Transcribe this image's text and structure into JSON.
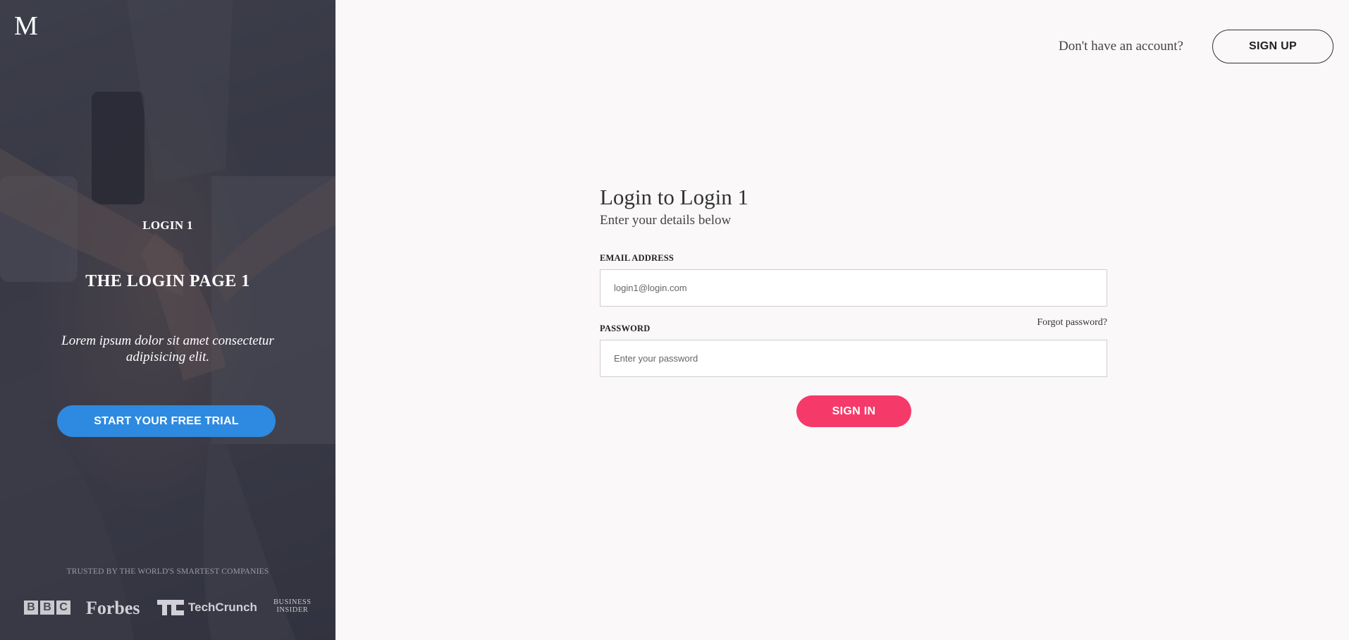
{
  "left_panel": {
    "logo": "M",
    "brand": "LOGIN 1",
    "headline": "THE LOGIN PAGE 1",
    "tagline": "Lorem ipsum dolor sit amet consectetur adipisicing elit.",
    "trial_button": "START YOUR FREE TRIAL",
    "trusted_text": "TRUSTED BY THE WORLD'S SMARTEST COMPANIES",
    "partner_logos": {
      "bbc": [
        "B",
        "B",
        "C"
      ],
      "forbes": "Forbes",
      "techcrunch": "TechCrunch",
      "business_insider": [
        "BUSINESS",
        "INSIDER"
      ]
    }
  },
  "header": {
    "prompt": "Don't have an account?",
    "signup_button": "SIGN UP"
  },
  "form": {
    "title": "Login to Login 1",
    "subtitle": "Enter your details below",
    "email_label": "EMAIL ADDRESS",
    "email_placeholder": "login1@login.com",
    "password_label": "PASSWORD",
    "password_placeholder": "Enter your password",
    "forgot_link": "Forgot password?",
    "signin_button": "SIGN IN"
  },
  "colors": {
    "accent_primary": "#2e8ae0",
    "accent_signin": "#f53a6a",
    "page_background": "#faf8f9",
    "left_overlay": "#2c2d3c"
  }
}
